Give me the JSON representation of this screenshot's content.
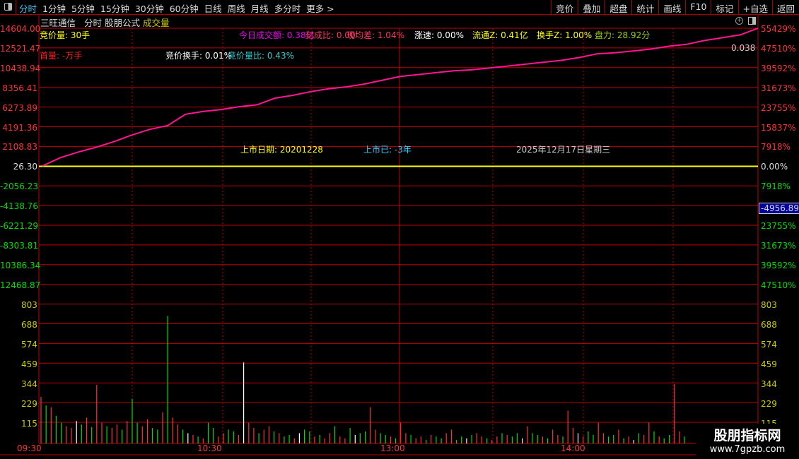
{
  "toolbar": {
    "periods": [
      "分时",
      "1分钟",
      "5分钟",
      "15分钟",
      "30分钟",
      "60分钟",
      "日线",
      "周线",
      "月线",
      "多分时",
      "更多 >"
    ],
    "active": "分时",
    "buttons": [
      "竞价",
      "叠加",
      "超盘",
      "统计",
      "画线",
      "F10",
      "标记",
      "+自选",
      "返回"
    ]
  },
  "header": {
    "stock": "三旺通信",
    "mode": "分时",
    "formula": "股朋公式",
    "indicator": "成交量"
  },
  "info": {
    "bid_vol": "竞价量: 30手",
    "first_vol": "首量: -万手",
    "turnover_today": "今日成交额: 0.38亿",
    "seal_ratio": "封成比: 0.00",
    "avg_diff": "现均差: 1.04%",
    "bid_turnover": "竞价换手: 0.01%",
    "bid_vol_ratio": "竞价量比: 0.43%",
    "speed": "涨速: 0.00%",
    "float_z": "流通Z: 0.41亿",
    "turnover_z": "换手Z: 1.00%",
    "pan_li": "盘力: 28.92分",
    "val_right": "0.038",
    "list_date": "上市日期: 20201228",
    "listed_years": "上市已: -3年",
    "date": "2025年12月17日星期三",
    "cursor_value": "-4956.89"
  },
  "price_axis_left": [
    "14604.00",
    "12521.47",
    "10438.94",
    "8356.41",
    "6273.89",
    "4191.36",
    "2108.83",
    "26.30",
    "-2056.23",
    "-4138.76",
    "-6221.29",
    "-8303.81",
    "10386.34",
    "12468.87"
  ],
  "price_axis_right": [
    "55429%",
    "47510%",
    "39592%",
    "31673%",
    "23755%",
    "15837%",
    "7918%",
    "0.00%",
    "7918%",
    "",
    "23755%",
    "31673%",
    "39592%",
    "47510%"
  ],
  "vol_axis": [
    "803",
    "688",
    "574",
    "459",
    "344",
    "229",
    "115"
  ],
  "time_axis": [
    "09:30",
    "10:30",
    "13:00",
    "14:00"
  ],
  "chart_data": {
    "type": "line",
    "price": [
      26.3,
      900,
      1500,
      2000,
      2600,
      3300,
      3900,
      4300,
      5500,
      5800,
      6000,
      6300,
      6500,
      7200,
      7500,
      7900,
      8200,
      8400,
      8700,
      9100,
      9500,
      9700,
      9900,
      10100,
      10200,
      10400,
      10600,
      10800,
      11000,
      11200,
      11500,
      11900,
      12000,
      12200,
      12400,
      12700,
      12900,
      13300,
      13600,
      13900,
      14604
    ],
    "volume": [
      270,
      220,
      210,
      160,
      120,
      100,
      90,
      130,
      110,
      150,
      95,
      340,
      120,
      100,
      90,
      110,
      80,
      130,
      260,
      120,
      100,
      140,
      90,
      80,
      180,
      740,
      150,
      110,
      80,
      60,
      50,
      40,
      30,
      120,
      90,
      40,
      60,
      80,
      70,
      50,
      470,
      120,
      90,
      60,
      80,
      100,
      70,
      60,
      40,
      50,
      30,
      60,
      80,
      70,
      40,
      50,
      30,
      60,
      100,
      40,
      30,
      90,
      50,
      60,
      70,
      210,
      80,
      60,
      50,
      40,
      30,
      120,
      60,
      50,
      30,
      40,
      20,
      50,
      40,
      30,
      60,
      80,
      20,
      40,
      30,
      50,
      60,
      40,
      30,
      20,
      40,
      60,
      50,
      40,
      60,
      30,
      100,
      60,
      50,
      40,
      30,
      80,
      50,
      40,
      190,
      90,
      60,
      40,
      70,
      50,
      120,
      60,
      40,
      50,
      80,
      30,
      40,
      20,
      60,
      50,
      120,
      70,
      40,
      30,
      50,
      345,
      70,
      40
    ],
    "colors": {
      "price": "#ff1493",
      "base": "#ffff00",
      "up": "#ff3333",
      "down": "#00dd00",
      "flat": "#ffffff",
      "grid": "#c00000"
    }
  }
}
